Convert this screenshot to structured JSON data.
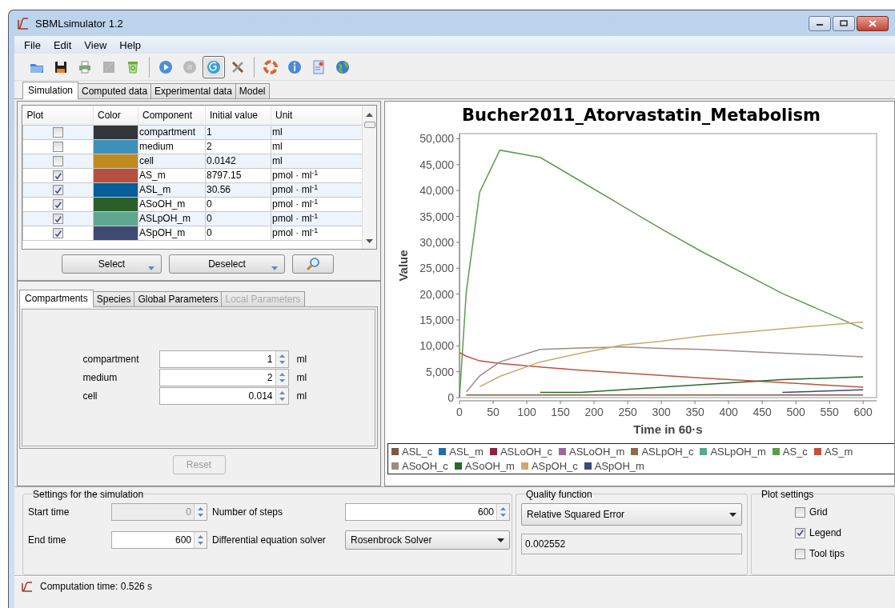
{
  "window": {
    "title": "SBMLsimulator 1.2"
  },
  "menu": [
    "File",
    "Edit",
    "View",
    "Help"
  ],
  "toolbar": [
    [
      {
        "disabled": false,
        "selected": false
      },
      {
        "disabled": false,
        "selected": false
      },
      {
        "disabled": false,
        "selected": false
      },
      {
        "disabled": true,
        "selected": false
      },
      {
        "disabled": false,
        "selected": false
      }
    ],
    [
      {
        "disabled": false,
        "selected": false
      },
      {
        "disabled": true,
        "selected": false
      },
      {
        "disabled": false,
        "selected": true
      },
      {
        "disabled": false,
        "selected": false
      }
    ],
    [
      {
        "disabled": false,
        "selected": false
      },
      {
        "disabled": false,
        "selected": false
      },
      {
        "disabled": false,
        "selected": false
      },
      {
        "disabled": false,
        "selected": false
      }
    ]
  ],
  "tabs": [
    {
      "label": "Simulation",
      "selected": true
    },
    {
      "label": "Computed data",
      "selected": false
    },
    {
      "label": "Experimental data",
      "selected": false
    },
    {
      "label": "Model",
      "selected": false
    }
  ],
  "component_table": {
    "columns": [
      "Plot",
      "Color",
      "Component",
      "Initial value",
      "Unit"
    ],
    "rows": [
      {
        "plot": false,
        "color": "#33373a",
        "component": "compartment",
        "initial_value": "1",
        "unit": "ml"
      },
      {
        "plot": false,
        "color": "#3f90b8",
        "component": "medium",
        "initial_value": "2",
        "unit": "ml"
      },
      {
        "plot": false,
        "color": "#c08a1e",
        "component": "cell",
        "initial_value": "0.0142",
        "unit": "ml"
      },
      {
        "plot": true,
        "color": "#b55040",
        "component": "AS_m",
        "initial_value": "8797.15",
        "unit": "pmol · ml$^{-1}$"
      },
      {
        "plot": true,
        "color": "#055e9a",
        "component": "ASL_m",
        "initial_value": "30.56",
        "unit": "pmol · ml$^{-1}$"
      },
      {
        "plot": true,
        "color": "#2b5e2a",
        "component": "ASoOH_m",
        "initial_value": "0",
        "unit": "pmol · ml$^{-1}$"
      },
      {
        "plot": true,
        "color": "#5ea890",
        "component": "ASLpOH_m",
        "initial_value": "0",
        "unit": "pmol · ml$^{-1}$"
      },
      {
        "plot": true,
        "color": "#3d4a72",
        "component": "ASpOH_m",
        "initial_value": "0",
        "unit": "pmol · ml$^{-1}$"
      }
    ]
  },
  "table_buttons": [
    {
      "label": "Select",
      "dropdown": true
    },
    {
      "label": "Deselect",
      "dropdown": true
    }
  ],
  "parameter_tabs": [
    {
      "label": "Compartments",
      "selected": true,
      "disabled": false
    },
    {
      "label": "Species",
      "selected": false,
      "disabled": false
    },
    {
      "label": "Global Parameters",
      "selected": false,
      "disabled": false
    },
    {
      "label": "Local Parameters",
      "selected": false,
      "disabled": true
    }
  ],
  "compartments": [
    {
      "label": "compartment",
      "value": "1",
      "unit": "ml"
    },
    {
      "label": "medium",
      "value": "2",
      "unit": "ml"
    },
    {
      "label": "cell",
      "value": "0.014",
      "unit": "ml"
    }
  ],
  "reset_button": {
    "label": "Reset",
    "disabled": true
  },
  "chart": {
    "chart_data": {
      "type": "line",
      "title": "Bucher2011_Atorvastatin_Metabolism",
      "xlabel": "Time in 60·s",
      "ylabel": "Value",
      "x": [
        0,
        10,
        30,
        60,
        120,
        180,
        240,
        300,
        360,
        480,
        600
      ],
      "legend": "bottom",
      "xlim": [
        0,
        620
      ],
      "ylim": [
        0,
        51000
      ],
      "xticks": [
        0,
        50,
        100,
        150,
        200,
        250,
        300,
        350,
        400,
        450,
        500,
        550,
        600
      ],
      "yticks": [
        {
          "value": 0,
          "label": "0"
        },
        {
          "value": 5000,
          "label": "5,000"
        },
        {
          "value": 10000,
          "label": "10,000"
        },
        {
          "value": 15000,
          "label": "15,000"
        },
        {
          "value": 20000,
          "label": "20,000"
        },
        {
          "value": 25000,
          "label": "25,000"
        },
        {
          "value": 30000,
          "label": "30,000"
        },
        {
          "value": 35000,
          "label": "35,000"
        },
        {
          "value": 40000,
          "label": "40,000"
        },
        {
          "value": 45000,
          "label": "45,000"
        },
        {
          "value": 50000,
          "label": "50,000"
        }
      ],
      "series": [
        {
          "name": "ASL_c",
          "color": "#7b5a42",
          "values": [
            null,
            500,
            500,
            500,
            500,
            500,
            500,
            500,
            500,
            500,
            500
          ]
        },
        {
          "name": "ASL_m",
          "color": "#1f6faa",
          "values": [
            null,
            null,
            null,
            null,
            null,
            null,
            null,
            null,
            null,
            null,
            null
          ]
        },
        {
          "name": "ASLoOH_c",
          "color": "#8e2442",
          "values": [
            null,
            null,
            null,
            null,
            null,
            null,
            null,
            null,
            null,
            null,
            null
          ]
        },
        {
          "name": "ASLoOH_m",
          "color": "#a066a0",
          "values": [
            null,
            null,
            null,
            null,
            null,
            null,
            null,
            null,
            null,
            null,
            null
          ]
        },
        {
          "name": "ASLpOH_c",
          "color": "#8c6e48",
          "values": [
            null,
            null,
            null,
            null,
            null,
            null,
            null,
            null,
            null,
            null,
            null
          ]
        },
        {
          "name": "ASLpOH_m",
          "color": "#5aa890",
          "values": [
            null,
            null,
            null,
            null,
            null,
            null,
            null,
            null,
            null,
            null,
            null
          ]
        },
        {
          "name": "AS_c",
          "color": "#5a9e4a",
          "values": [
            0,
            20300,
            39700,
            47800,
            46400,
            41800,
            37200,
            32600,
            28200,
            20100,
            13300
          ]
        },
        {
          "name": "AS_m",
          "color": "#c0503e",
          "values": [
            8700,
            8000,
            7100,
            6600,
            5900,
            5300,
            4800,
            4300,
            3800,
            2900,
            2000
          ]
        },
        {
          "name": "ASoOH_c",
          "color": "#a08a88",
          "values": [
            null,
            1100,
            4200,
            6900,
            9300,
            9600,
            9800,
            9500,
            9300,
            8600,
            7900
          ]
        },
        {
          "name": "ASoOH_m",
          "color": "#2a6a2a",
          "values": [
            null,
            null,
            null,
            null,
            1000,
            1000,
            1500,
            2000,
            2500,
            3500,
            4000
          ]
        },
        {
          "name": "ASpOH_c",
          "color": "#c8aa6a",
          "values": [
            null,
            null,
            2100,
            4100,
            6900,
            8600,
            10100,
            10900,
            11900,
            13300,
            14600
          ]
        },
        {
          "name": "ASpOH_m",
          "color": "#3c4a7a",
          "values": [
            null,
            null,
            null,
            null,
            null,
            null,
            null,
            null,
            null,
            1000,
            1500
          ]
        }
      ]
    }
  },
  "simulation_settings": {
    "title": "Settings for the simulation",
    "fields": [
      {
        "kind": "spinner",
        "label": "Start time",
        "value": "0",
        "disabled": true
      },
      {
        "kind": "spinner",
        "label": "Number of steps",
        "value": "600",
        "disabled": false
      },
      {
        "kind": "spinner",
        "label": "End time",
        "value": "600",
        "disabled": false
      },
      {
        "kind": "dropdown",
        "label": "Differential equation solver",
        "value": "Rosenbrock Solver",
        "disabled": false
      }
    ]
  },
  "quality_function": {
    "title": "Quality function",
    "value": "Relative Squared Error",
    "result": "0.002552"
  },
  "plot_settings": {
    "title": "Plot settings",
    "options": [
      {
        "label": "Grid",
        "checked": false
      },
      {
        "label": "Legend",
        "checked": true
      },
      {
        "label": "Tool tips",
        "checked": false
      }
    ]
  },
  "status_bar": {
    "text": "Computation time: 0.526 s"
  }
}
